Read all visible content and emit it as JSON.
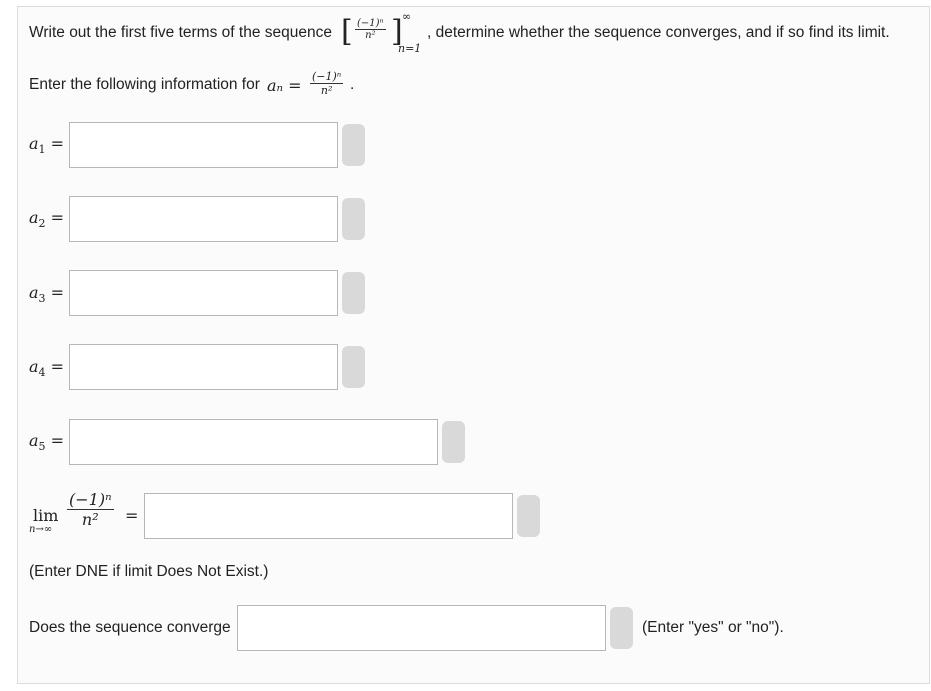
{
  "question": {
    "intro_prefix": "Write out the first five terms of the sequence",
    "seq_num": "(−1)ⁿ",
    "seq_den": "n²",
    "seq_upper": "∞",
    "seq_lower": "n=1",
    "intro_suffix": ", determine whether the sequence converges, and if so find its limit.",
    "info_prefix": "Enter the following information for",
    "an_label": "aₙ =",
    "an_num": "(−1)ⁿ",
    "an_den": "n²",
    "info_suffix": "."
  },
  "terms": [
    {
      "label": "a",
      "sub": "1",
      "eq": "=",
      "value": ""
    },
    {
      "label": "a",
      "sub": "2",
      "eq": "=",
      "value": ""
    },
    {
      "label": "a",
      "sub": "3",
      "eq": "=",
      "value": ""
    },
    {
      "label": "a",
      "sub": "4",
      "eq": "=",
      "value": ""
    },
    {
      "label": "a",
      "sub": "5",
      "eq": "=",
      "value": ""
    }
  ],
  "limit": {
    "lim": "lim",
    "under": "n→∞",
    "num": "(−1)ⁿ",
    "den": "n²",
    "eq": "=",
    "value": "",
    "hint": "(Enter DNE if limit Does Not Exist.)"
  },
  "converge": {
    "prompt": "Does the sequence converge",
    "value": "",
    "hint": "(Enter \"yes\" or \"no\")."
  }
}
